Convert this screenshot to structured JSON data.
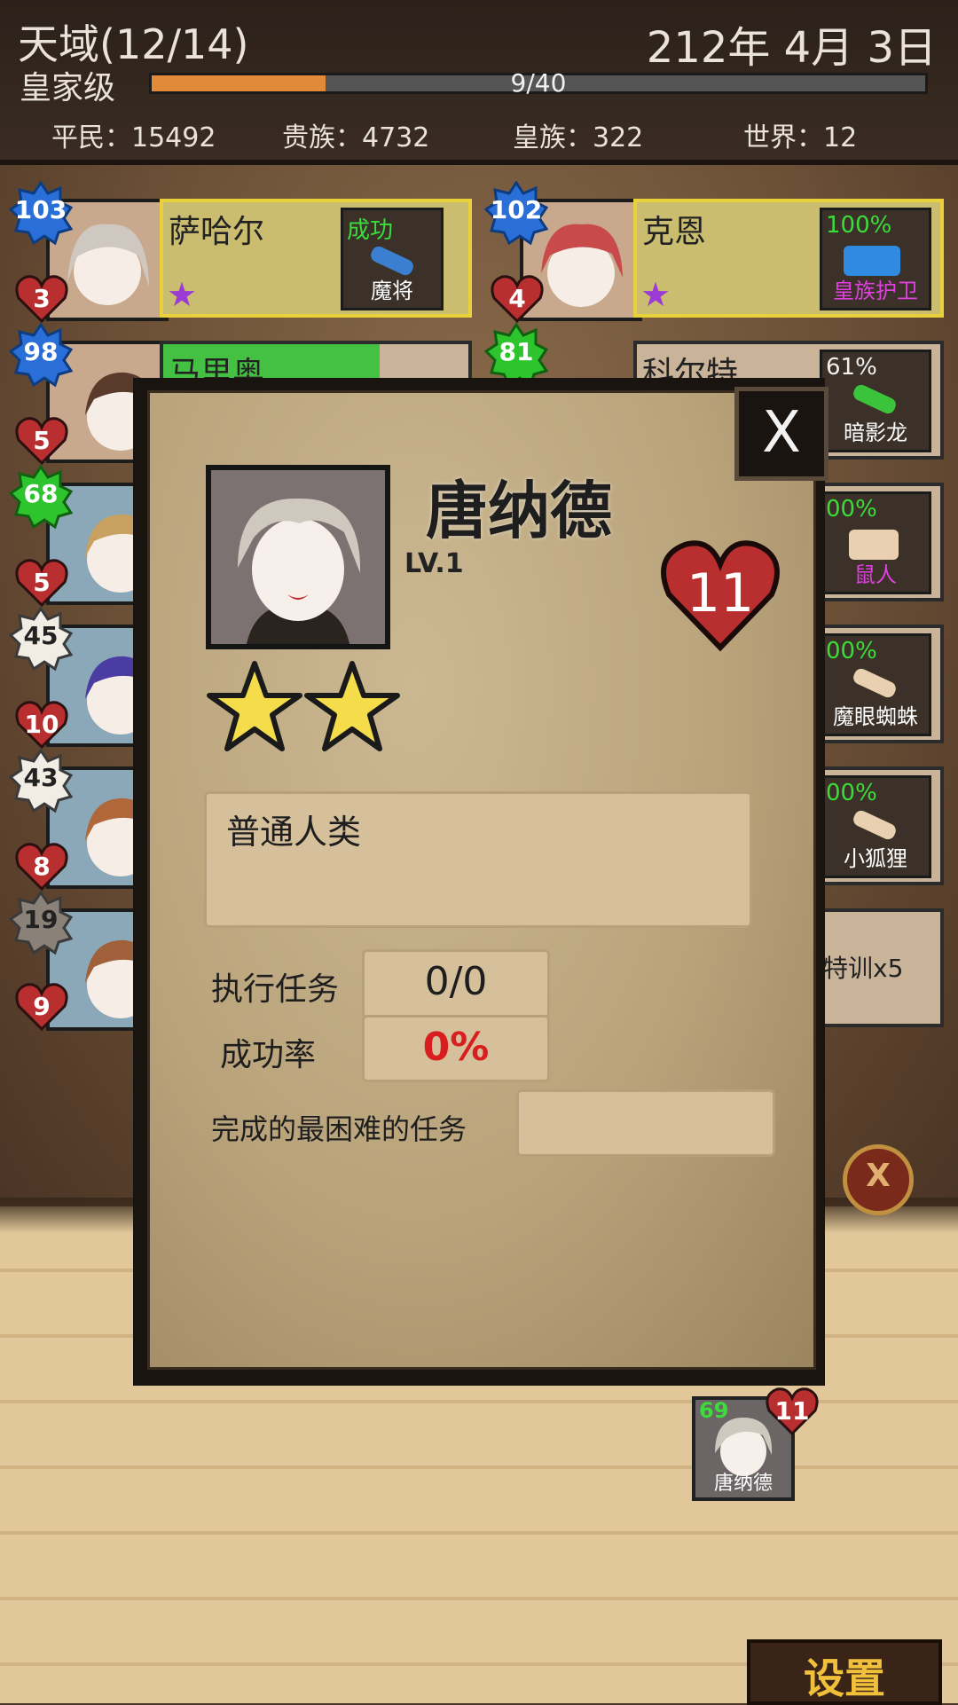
{
  "header": {
    "title": "天域(12/14)",
    "date": "212年 4月 3日",
    "rank": "皇家级",
    "progress_text": "9/40",
    "progress_fraction": 0.225,
    "stats": [
      "平民：15492",
      "贵族：4732",
      "皇族：322",
      "世界：12"
    ]
  },
  "heroes_left": [
    {
      "level": "103",
      "hp": "3",
      "name": "萨哈尔",
      "mission_status": "成功",
      "mission": "魔将",
      "star": "★"
    },
    {
      "level": "98",
      "hp": "5",
      "name": "马里奥"
    },
    {
      "level": "68",
      "hp": "5"
    },
    {
      "level": "45",
      "hp": "10"
    },
    {
      "level": "43",
      "hp": "8"
    },
    {
      "level": "19",
      "hp": "9"
    }
  ],
  "heroes_right": [
    {
      "level": "102",
      "hp": "4",
      "name": "克恩",
      "mission_pct": "100%",
      "mission": "皇族护卫",
      "star": "★"
    },
    {
      "level": "81",
      "name": "科尔特",
      "mission_pct": "61%",
      "mission": "暗影龙"
    },
    {
      "mission_pct": "00%",
      "mission": "鼠人"
    },
    {
      "mission_pct": "00%",
      "mission": "魔眼蜘蛛"
    },
    {
      "mission_pct": "00%",
      "mission": "小狐狸"
    },
    {
      "mission": "特训x5"
    }
  ],
  "modal": {
    "close_label": "X",
    "name": "唐纳德",
    "level": "LV.1",
    "hp": "11",
    "stars": 2,
    "race": "普通人类",
    "missions_label": "执行任务",
    "missions_value": "0/0",
    "success_label": "成功率",
    "success_value": "0%",
    "hardest_label": "完成的最困难的任务",
    "hardest_value": ""
  },
  "bottom": {
    "mini_level": "69",
    "mini_hp": "11",
    "mini_name": "唐纳德",
    "emblem": "X",
    "settings_label": "设置"
  },
  "colors": {
    "accent_orange": "#e08a3a",
    "success_red": "#d81e1e",
    "mission_green": "#3bdc3b",
    "mission_magenta": "#e040e0"
  }
}
